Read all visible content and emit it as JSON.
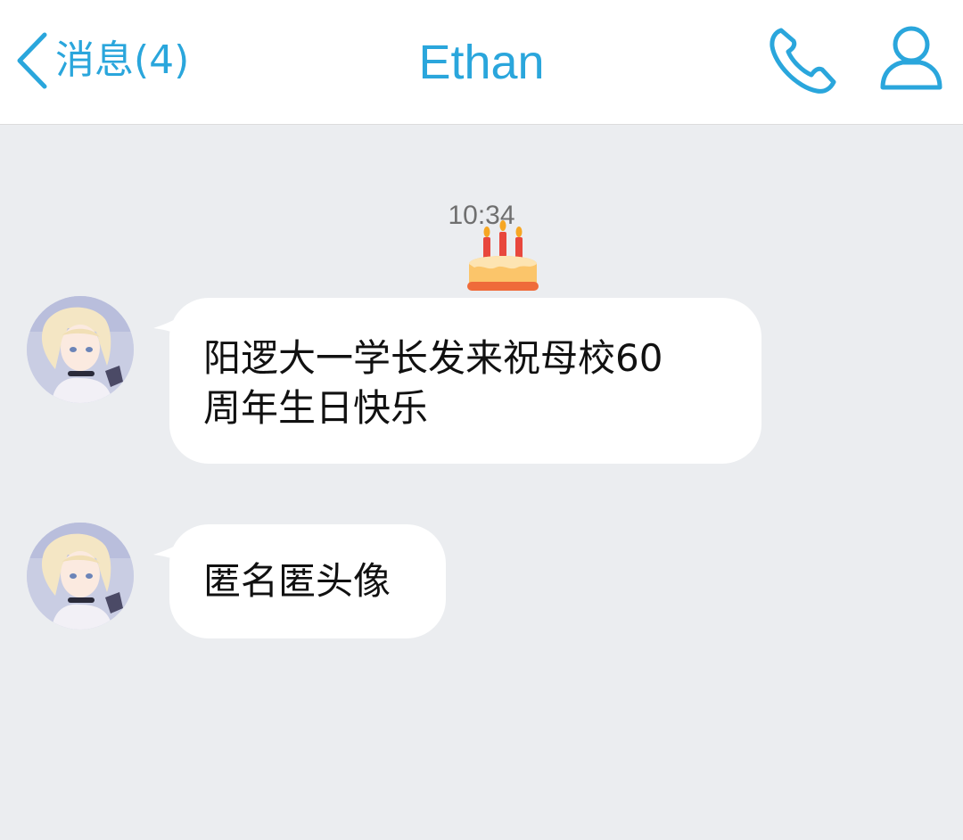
{
  "header": {
    "back_label": "消息(4)",
    "title": "Ethan",
    "accent_color": "#2aa6dc",
    "back_icon": "chevron-left-icon",
    "call_icon": "phone-icon",
    "profile_icon": "user-icon"
  },
  "chat": {
    "timestamp": "10:34",
    "cake_icon": "birthday-cake-icon",
    "messages": [
      {
        "sender_avatar": "anime-girl-avatar",
        "line1": "阳逻大一学长发来祝母校60",
        "line2": "周年生日快乐"
      },
      {
        "sender_avatar": "anime-girl-avatar",
        "line1": "匿名匿头像"
      }
    ]
  }
}
